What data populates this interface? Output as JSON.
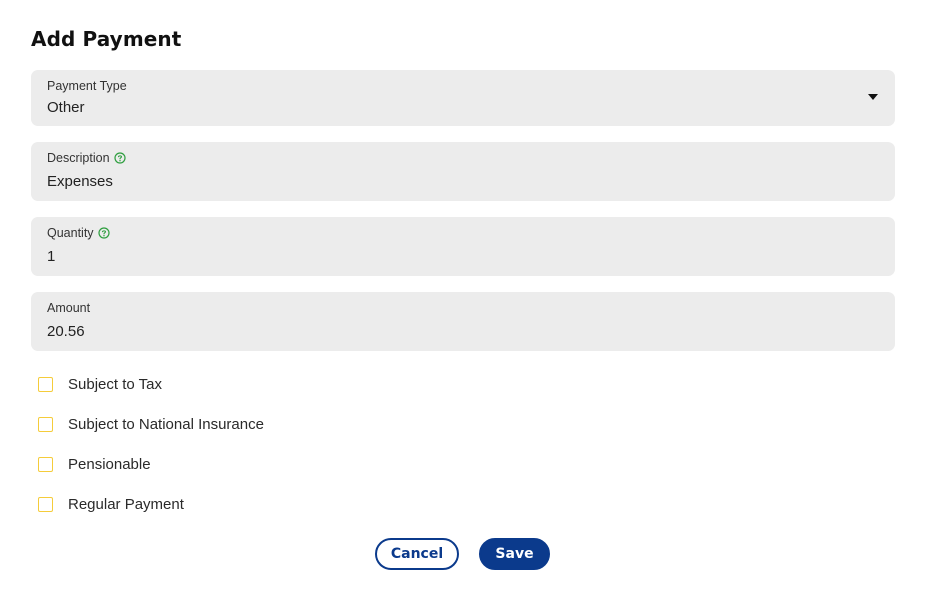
{
  "dialog": {
    "title": "Add Payment"
  },
  "fields": {
    "payment_type": {
      "label": "Payment Type",
      "value": "Other"
    },
    "description": {
      "label": "Description",
      "value": "Expenses"
    },
    "quantity": {
      "label": "Quantity",
      "value": "1"
    },
    "amount": {
      "label": "Amount",
      "value": "20.56"
    }
  },
  "checkboxes": [
    {
      "label": "Subject to Tax",
      "checked": false
    },
    {
      "label": "Subject to National Insurance",
      "checked": false
    },
    {
      "label": "Pensionable",
      "checked": false
    },
    {
      "label": "Regular Payment",
      "checked": false
    }
  ],
  "buttons": {
    "cancel_label": "Cancel",
    "save_label": "Save"
  },
  "colors": {
    "accent": "#0b3a8c",
    "checkbox_border": "#f5cc3a",
    "help_icon": "#2e9e3f",
    "field_background": "#ececec"
  },
  "icons": {
    "help": "help-circle-icon",
    "dropdown": "caret-down-icon"
  }
}
